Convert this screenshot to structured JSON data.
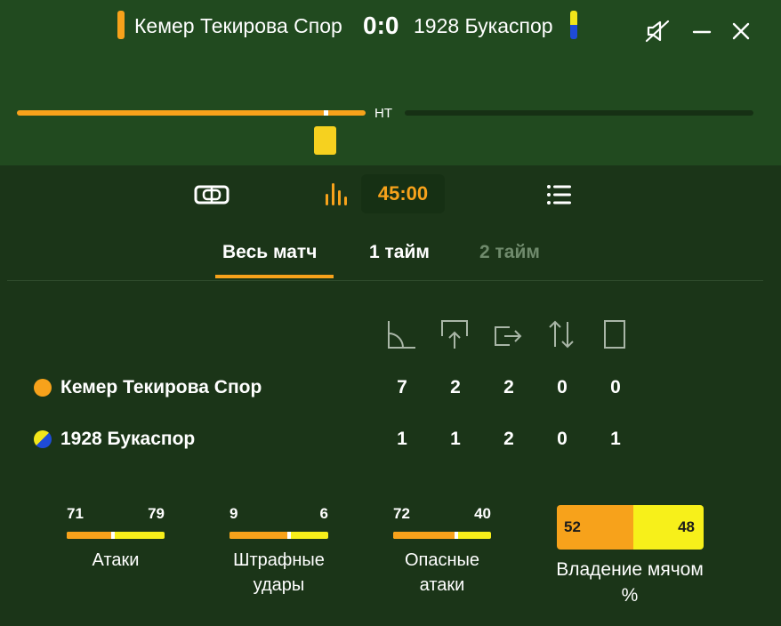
{
  "match": {
    "home_team": "Кемер Текирова Спор",
    "away_team": "1928 Букаспор",
    "score": "0:0",
    "home_color": "#f7a21b",
    "away_colors": [
      "#f2e51a",
      "#1f4bd8"
    ]
  },
  "header_icons": [
    "sound-muted-icon",
    "minimize-icon",
    "close-icon"
  ],
  "timeline": {
    "halftime_label": "HT",
    "first_half_progress": 1.0,
    "second_half_progress": 0.0,
    "events": [
      "yellow-card"
    ]
  },
  "toolbar": {
    "match_time": "45:00",
    "icons": [
      "field-icon",
      "stats-icon",
      "list-icon"
    ]
  },
  "tabs": [
    {
      "label": "Весь матч",
      "active": true
    },
    {
      "label": "1 тайм",
      "active": false
    },
    {
      "label": "2 тайм",
      "active": false,
      "disabled": true
    }
  ],
  "stat_columns": [
    "corner-icon",
    "shot-on-target-icon",
    "shot-off-target-icon",
    "substitution-icon",
    "yellow-card-icon"
  ],
  "stats_table": {
    "home": {
      "name": "Кемер Текирова Спор",
      "values": [
        "7",
        "2",
        "2",
        "0",
        "0"
      ]
    },
    "away": {
      "name": "1928 Букаспор",
      "values": [
        "1",
        "1",
        "2",
        "0",
        "1"
      ]
    }
  },
  "metrics": [
    {
      "label": "Атаки",
      "home": "71",
      "away": "79"
    },
    {
      "label": "Штрафные удары",
      "home": "9",
      "away": "6"
    },
    {
      "label": "Опасные атаки",
      "home": "72",
      "away": "40"
    }
  ],
  "possession": {
    "label": "Владение мячом %",
    "home": "52",
    "away": "48"
  }
}
